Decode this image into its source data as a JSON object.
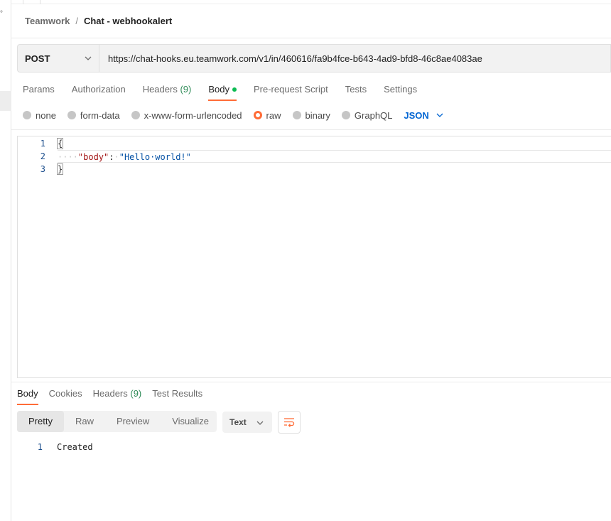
{
  "breadcrumb": {
    "parent": "Teamwork",
    "separator": "/",
    "current": "Chat - webhookalert"
  },
  "request": {
    "method": "POST",
    "url": "https://chat-hooks.eu.teamwork.com/v1/in/460616/fa9b4fce-b643-4ad9-bfd8-46c8ae4083ae"
  },
  "request_tabs": {
    "params": "Params",
    "authorization": "Authorization",
    "headers": "Headers",
    "headers_count": "(9)",
    "body": "Body",
    "prerequest": "Pre-request Script",
    "tests": "Tests",
    "settings": "Settings"
  },
  "body_types": {
    "none": "none",
    "form_data": "form-data",
    "urlencoded": "x-www-form-urlencoded",
    "raw": "raw",
    "binary": "binary",
    "graphql": "GraphQL",
    "selected": "raw",
    "language": "JSON"
  },
  "editor": {
    "line_numbers": [
      "1",
      "2",
      "3"
    ],
    "line1": "{",
    "line2_indent": "····",
    "line2_key": "\"body\"",
    "line2_colon": ":",
    "line2_space": "·",
    "line2_value": "\"Hello·world!\"",
    "line3": "}"
  },
  "response_tabs": {
    "body": "Body",
    "cookies": "Cookies",
    "headers": "Headers",
    "headers_count": "(9)",
    "test_results": "Test Results"
  },
  "response_view": {
    "pretty": "Pretty",
    "raw": "Raw",
    "preview": "Preview",
    "visualize": "Visualize",
    "format": "Text"
  },
  "response_body": {
    "line_no": "1",
    "text": "Created"
  },
  "colors": {
    "accent": "#ff6c37",
    "link": "#0265d2",
    "count": "#2e8b57",
    "dot": "#0cbb52"
  }
}
